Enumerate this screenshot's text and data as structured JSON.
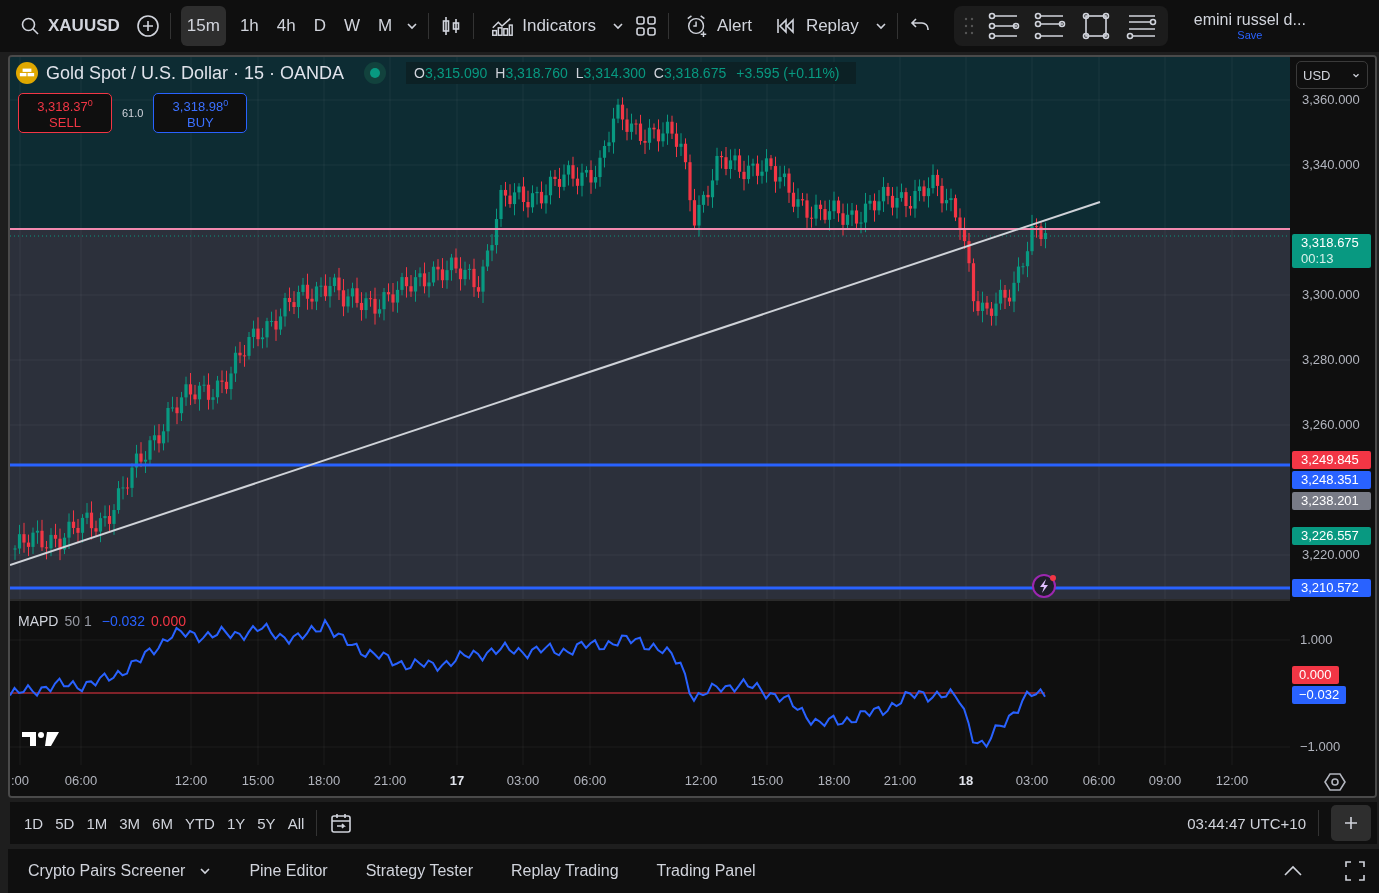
{
  "toolbar": {
    "symbol": "XAUUSD",
    "intervals": [
      {
        "label": "15m",
        "selected": true
      },
      {
        "label": "1h",
        "selected": false
      },
      {
        "label": "4h",
        "selected": false
      },
      {
        "label": "D",
        "selected": false
      },
      {
        "label": "W",
        "selected": false
      },
      {
        "label": "M",
        "selected": false
      }
    ],
    "indicators": "Indicators",
    "alert": "Alert",
    "replay": "Replay",
    "layout": {
      "name": "emini russel d...",
      "status": "Save"
    }
  },
  "legend": {
    "title": "Gold Spot / U.S. Dollar · 15 · OANDA",
    "ohlc": [
      {
        "key": "O",
        "value": "3,315.090"
      },
      {
        "key": "H",
        "value": "3,318.760"
      },
      {
        "key": "L",
        "value": "3,314.300"
      },
      {
        "key": "C",
        "value": "3,318.675"
      }
    ],
    "change": "+3.595 (+0.11%)"
  },
  "trade": {
    "sell": {
      "price": "3,318.37",
      "tail": "0",
      "label": "SELL"
    },
    "spread": "61.0",
    "buy": {
      "price": "3,318.98",
      "tail": "0",
      "label": "BUY"
    }
  },
  "price_axis": {
    "currency": "USD",
    "ticks": [
      "3,360.000",
      "3,340.000",
      "3,300.000",
      "3,280.000",
      "3,260.000",
      "3,220.000"
    ],
    "labels": [
      {
        "text": "3,318.675",
        "sub": "00:13",
        "color": "#089981"
      },
      {
        "text": "3,249.845",
        "color": "#f23645"
      },
      {
        "text": "3,248.351",
        "color": "#2962ff"
      },
      {
        "text": "3,238.201",
        "color": "#787b86"
      },
      {
        "text": "3,226.557",
        "color": "#089981"
      },
      {
        "text": "3,210.572",
        "color": "#2962ff"
      }
    ]
  },
  "indicator": {
    "name": "MAPD",
    "params": "50 1",
    "values": [
      {
        "text": "−0.032",
        "color": "#2962ff"
      },
      {
        "text": "0.000",
        "color": "#f23645"
      }
    ],
    "ticks": [
      "1.000",
      "−1.000"
    ],
    "labels": [
      {
        "text": "0.000",
        "color": "#f23645"
      },
      {
        "text": "−0.032",
        "color": "#2962ff"
      }
    ]
  },
  "time_axis": [
    {
      "label": ":00",
      "bold": false
    },
    {
      "label": "06:00",
      "bold": false
    },
    {
      "label": "12:00",
      "bold": false
    },
    {
      "label": "15:00",
      "bold": false
    },
    {
      "label": "18:00",
      "bold": false
    },
    {
      "label": "21:00",
      "bold": false
    },
    {
      "label": "17",
      "bold": true
    },
    {
      "label": "03:00",
      "bold": false
    },
    {
      "label": "06:00",
      "bold": false
    },
    {
      "label": "12:00",
      "bold": false
    },
    {
      "label": "15:00",
      "bold": false
    },
    {
      "label": "18:00",
      "bold": false
    },
    {
      "label": "21:00",
      "bold": false
    },
    {
      "label": "18",
      "bold": true
    },
    {
      "label": "03:00",
      "bold": false
    },
    {
      "label": "06:00",
      "bold": false
    },
    {
      "label": "09:00",
      "bold": false
    },
    {
      "label": "12:00",
      "bold": false
    }
  ],
  "ranges": [
    "1D",
    "5D",
    "1M",
    "3M",
    "6M",
    "YTD",
    "1Y",
    "5Y",
    "All"
  ],
  "clock": "03:44:47 UTC+10",
  "bottom_tabs": [
    {
      "label": "Crypto Pairs Screener",
      "dropdown": true
    },
    {
      "label": "Pine Editor",
      "dropdown": false
    },
    {
      "label": "Strategy Tester",
      "dropdown": false
    },
    {
      "label": "Replay Trading",
      "dropdown": false
    },
    {
      "label": "Trading Panel",
      "dropdown": false
    }
  ]
}
